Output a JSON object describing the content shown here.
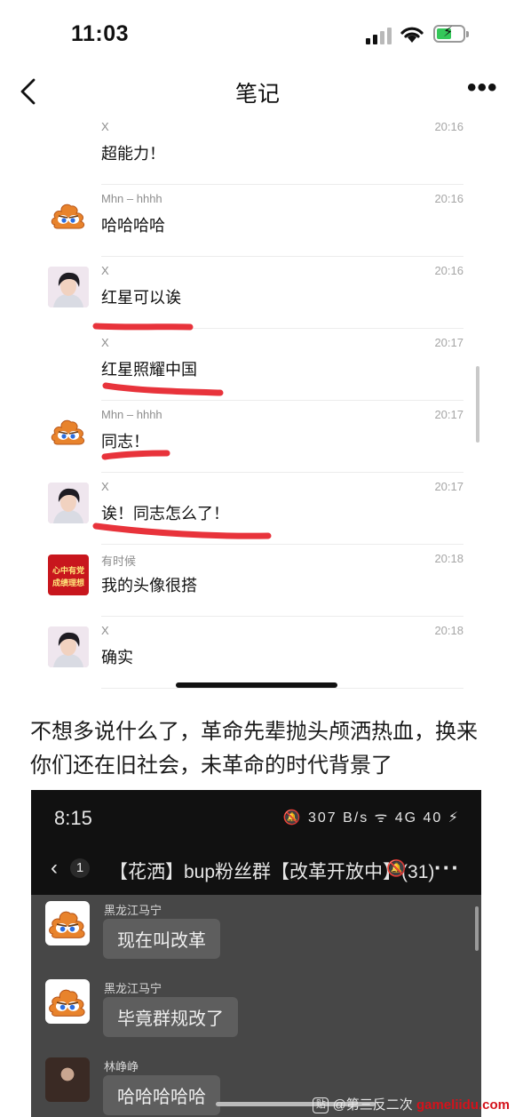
{
  "statusbar": {
    "time": "11:03"
  },
  "navbar": {
    "title": "笔记",
    "back_icon": "chevron-left-icon",
    "more_icon": "ellipsis-icon"
  },
  "records": [
    {
      "sender": "X",
      "time": "20:16",
      "text": "超能力！",
      "avatar": "none"
    },
    {
      "sender": "Mhn – hhhh",
      "time": "20:16",
      "text": "哈哈哈哈",
      "avatar": "poop"
    },
    {
      "sender": "X",
      "time": "20:16",
      "text": "红星可以诶",
      "avatar": "boy"
    },
    {
      "sender": "X",
      "time": "20:17",
      "text": "红星照耀中国",
      "avatar": "none"
    },
    {
      "sender": "Mhn – hhhh",
      "time": "20:17",
      "text": "同志！",
      "avatar": "poop"
    },
    {
      "sender": "X",
      "time": "20:17",
      "text": "诶！同志怎么了！",
      "avatar": "boy"
    },
    {
      "sender": "有时候",
      "time": "20:18",
      "text": "我的头像很搭",
      "avatar": "red",
      "avatar_text": [
        "心中有党",
        "成绩理想"
      ]
    },
    {
      "sender": "X",
      "time": "20:18",
      "text": "确实",
      "avatar": "boy"
    },
    {
      "sender": "X",
      "time": "20:18",
      "text": "",
      "avatar": "none"
    }
  ],
  "caption": "不想多说什么了，革命先辈抛头颅洒热血，换来你们还在旧社会，未革命的时代背景了",
  "shot2": {
    "time": "8:15",
    "status_icons": "🔕 307 B/s ᯤ 4G 40 ⚡",
    "badge": "1",
    "title": "【花洒】bup粉丝群【改革开放中】(31)",
    "messages": [
      {
        "name": "黑龙江马宁",
        "text": "现在叫改革",
        "avatar": "poop"
      },
      {
        "name": "黑龙江马宁",
        "text": "毕竟群规改了",
        "avatar": "poop"
      },
      {
        "name": "林峥峥",
        "text": "哈哈哈哈哈",
        "avatar": "dark"
      }
    ]
  },
  "watermark": {
    "text": "@第三反二次",
    "site": "gameliidu.com",
    "icon": "watermark-logo-icon"
  },
  "colors": {
    "highlight_red": "#e8333b",
    "dark_bubble": "#5e5e5e"
  }
}
